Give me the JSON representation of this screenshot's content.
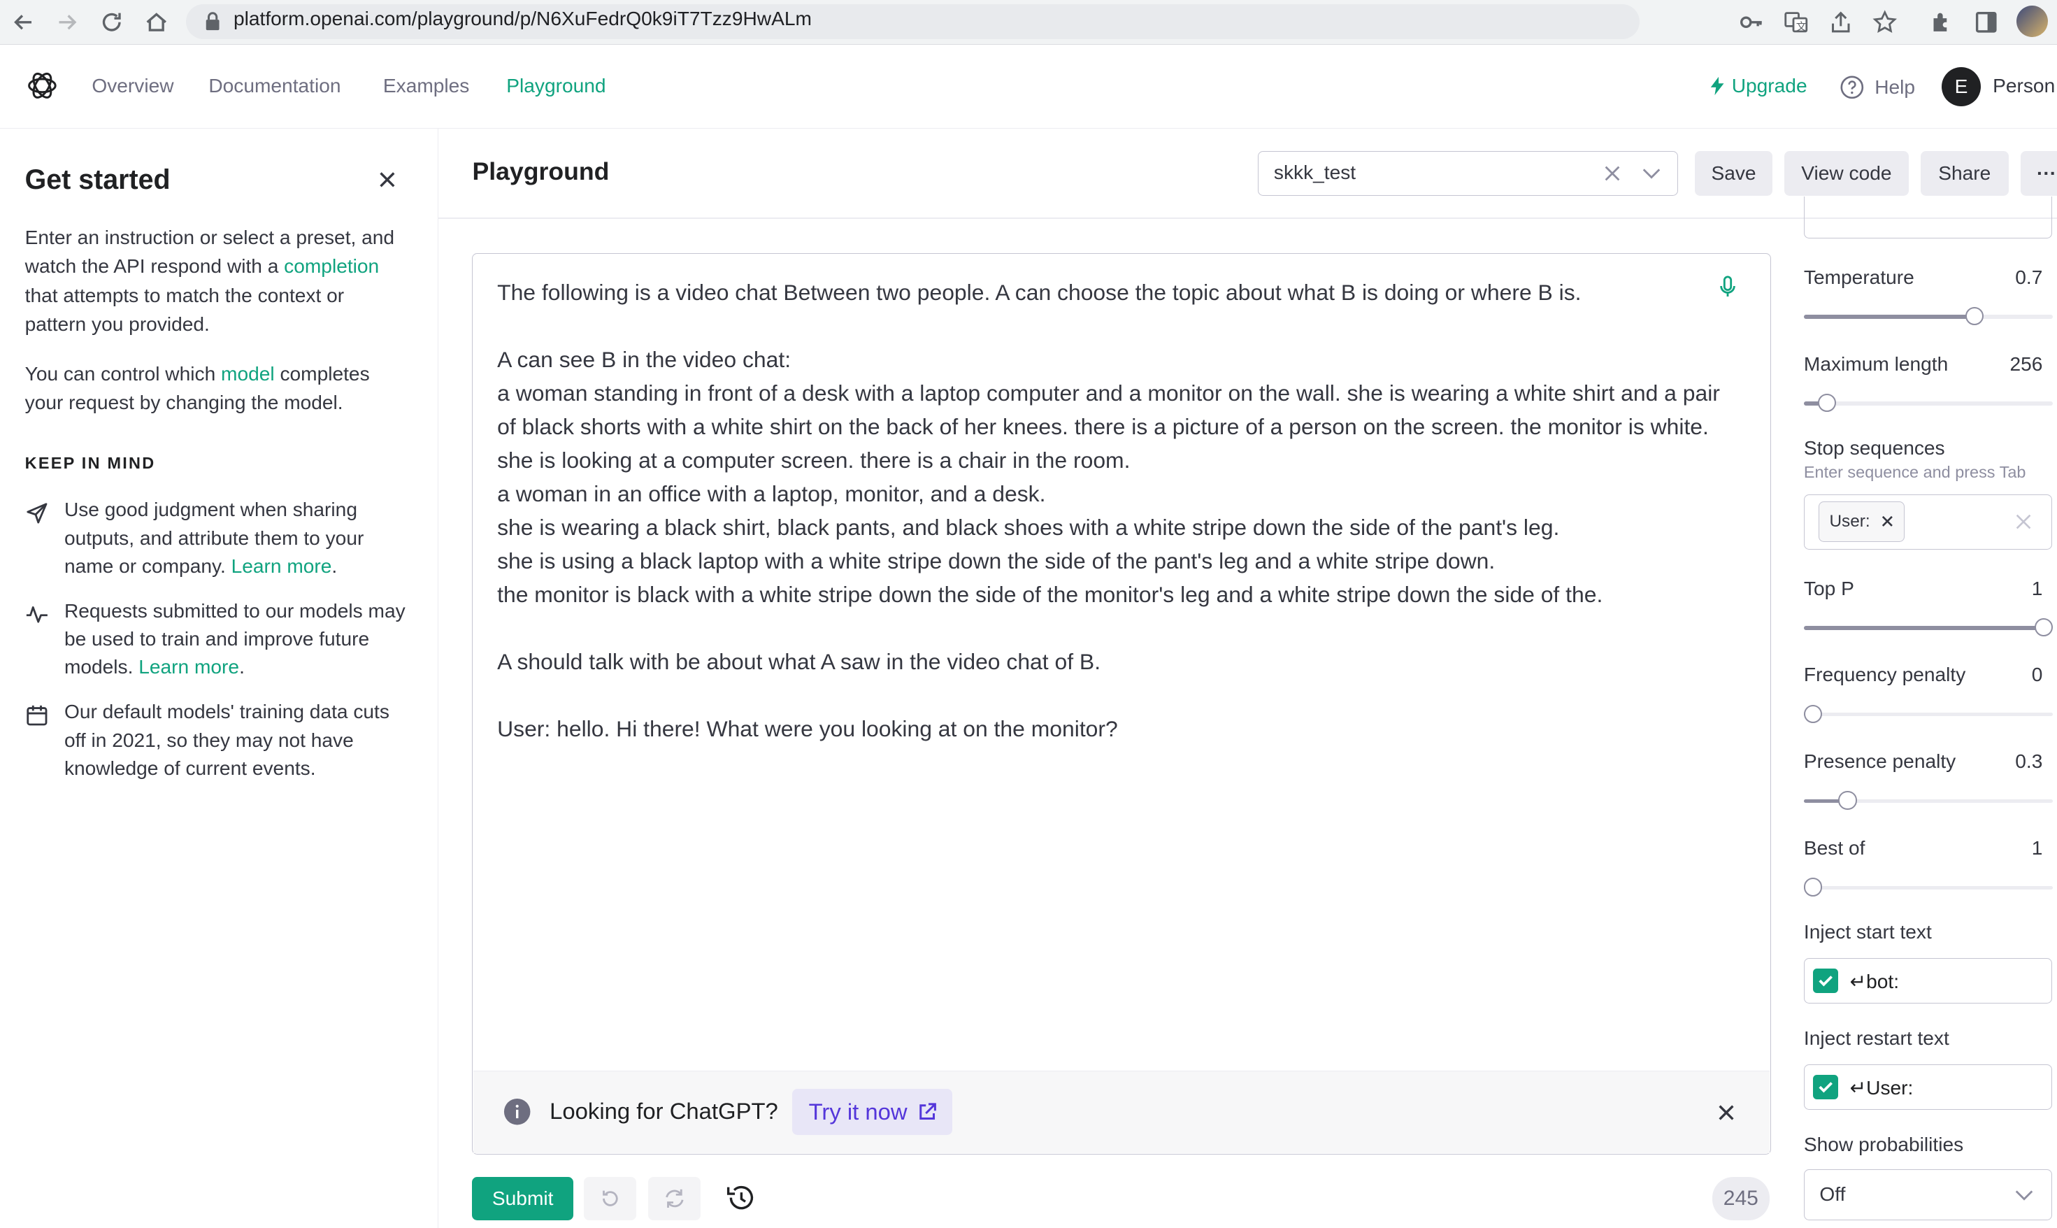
{
  "browser": {
    "url": "platform.openai.com/playground/p/N6XuFedrQ0k9iT7Tzz9HwALm"
  },
  "header": {
    "nav": [
      {
        "label": "Overview"
      },
      {
        "label": "Documentation"
      },
      {
        "label": "Examples"
      },
      {
        "label": "Playground"
      }
    ],
    "upgrade_label": "Upgrade",
    "help_label": "Help",
    "avatar_initial": "E",
    "user_label": "Person"
  },
  "sidebar": {
    "title": "Get started",
    "intro_1": "Enter an instruction or select a preset, and watch the API respond with a ",
    "intro_link": "completion",
    "intro_2": " that attempts to match the context or pattern you provided.",
    "model_1": "You can control which ",
    "model_link": "model",
    "model_2": " completes your request by changing the model.",
    "keep_in_mind": "KEEP IN MIND",
    "tips": [
      {
        "text": "Use good judgment when sharing outputs, and attribute them to your name or company. ",
        "link": "Learn more",
        "end": ".",
        "icon": "send-icon"
      },
      {
        "text": "Requests submitted to our models may be used to train and improve future models. ",
        "link": "Learn more",
        "end": ".",
        "icon": "activity-icon"
      },
      {
        "text": "Our default models' training data cuts off in 2021, so they may not have knowledge of current events.",
        "link": "",
        "end": "",
        "icon": "calendar-icon"
      }
    ]
  },
  "main": {
    "title": "Playground",
    "preset_value": "skkk_test",
    "save_label": "Save",
    "view_code_label": "View code",
    "share_label": "Share",
    "more_label": "···",
    "prompt": "The following is a video chat Between two people. A can choose the topic about what B is doing or where B is.\n\nA can see B in the video chat:\na woman standing in front of a desk with a laptop computer and a monitor on the wall. she is wearing a white shirt and a pair of black shorts with a white shirt on the back of her knees. there is a picture of a person on the screen. the monitor is white. she is looking at a computer screen. there is a chair in the room.\na woman in an office with a laptop, monitor, and a desk.\nshe is wearing a black shirt, black pants, and black shoes with a white stripe down the side of the pant's leg.\nshe is using a black laptop with a white stripe down the side of the pant's leg and a white stripe down.\nthe monitor is black with a white stripe down the side of the monitor's leg and a white stripe down the side of the.\n\nA should talk with be about what A saw in the video chat of B.\n\nUser: hello. Hi there! What were you looking at on the monitor?",
    "banner_text": "Looking for ChatGPT?",
    "banner_button": "Try it now",
    "submit_label": "Submit",
    "token_count": "245"
  },
  "settings": {
    "temperature": {
      "label": "Temperature",
      "value": "0.7",
      "fraction": 0.7
    },
    "max_length": {
      "label": "Maximum length",
      "value": "256",
      "fraction": 0.06
    },
    "stop_sequences": {
      "label": "Stop sequences",
      "hint": "Enter sequence and press Tab",
      "chip": "User:"
    },
    "top_p": {
      "label": "Top P",
      "value": "1",
      "fraction": 1.0
    },
    "frequency_penalty": {
      "label": "Frequency penalty",
      "value": "0",
      "fraction": 0.0
    },
    "presence_penalty": {
      "label": "Presence penalty",
      "value": "0.3",
      "fraction": 0.15
    },
    "best_of": {
      "label": "Best of",
      "value": "1",
      "fraction": 0.0
    },
    "inject_start": {
      "label": "Inject start text",
      "value": "↵bot:"
    },
    "inject_restart": {
      "label": "Inject restart text",
      "value": "↵User:"
    },
    "show_probabilities": {
      "label": "Show probabilities",
      "value": "Off"
    }
  },
  "colors": {
    "accent": "#10a37f",
    "chatgpt_accent": "#5436da"
  }
}
